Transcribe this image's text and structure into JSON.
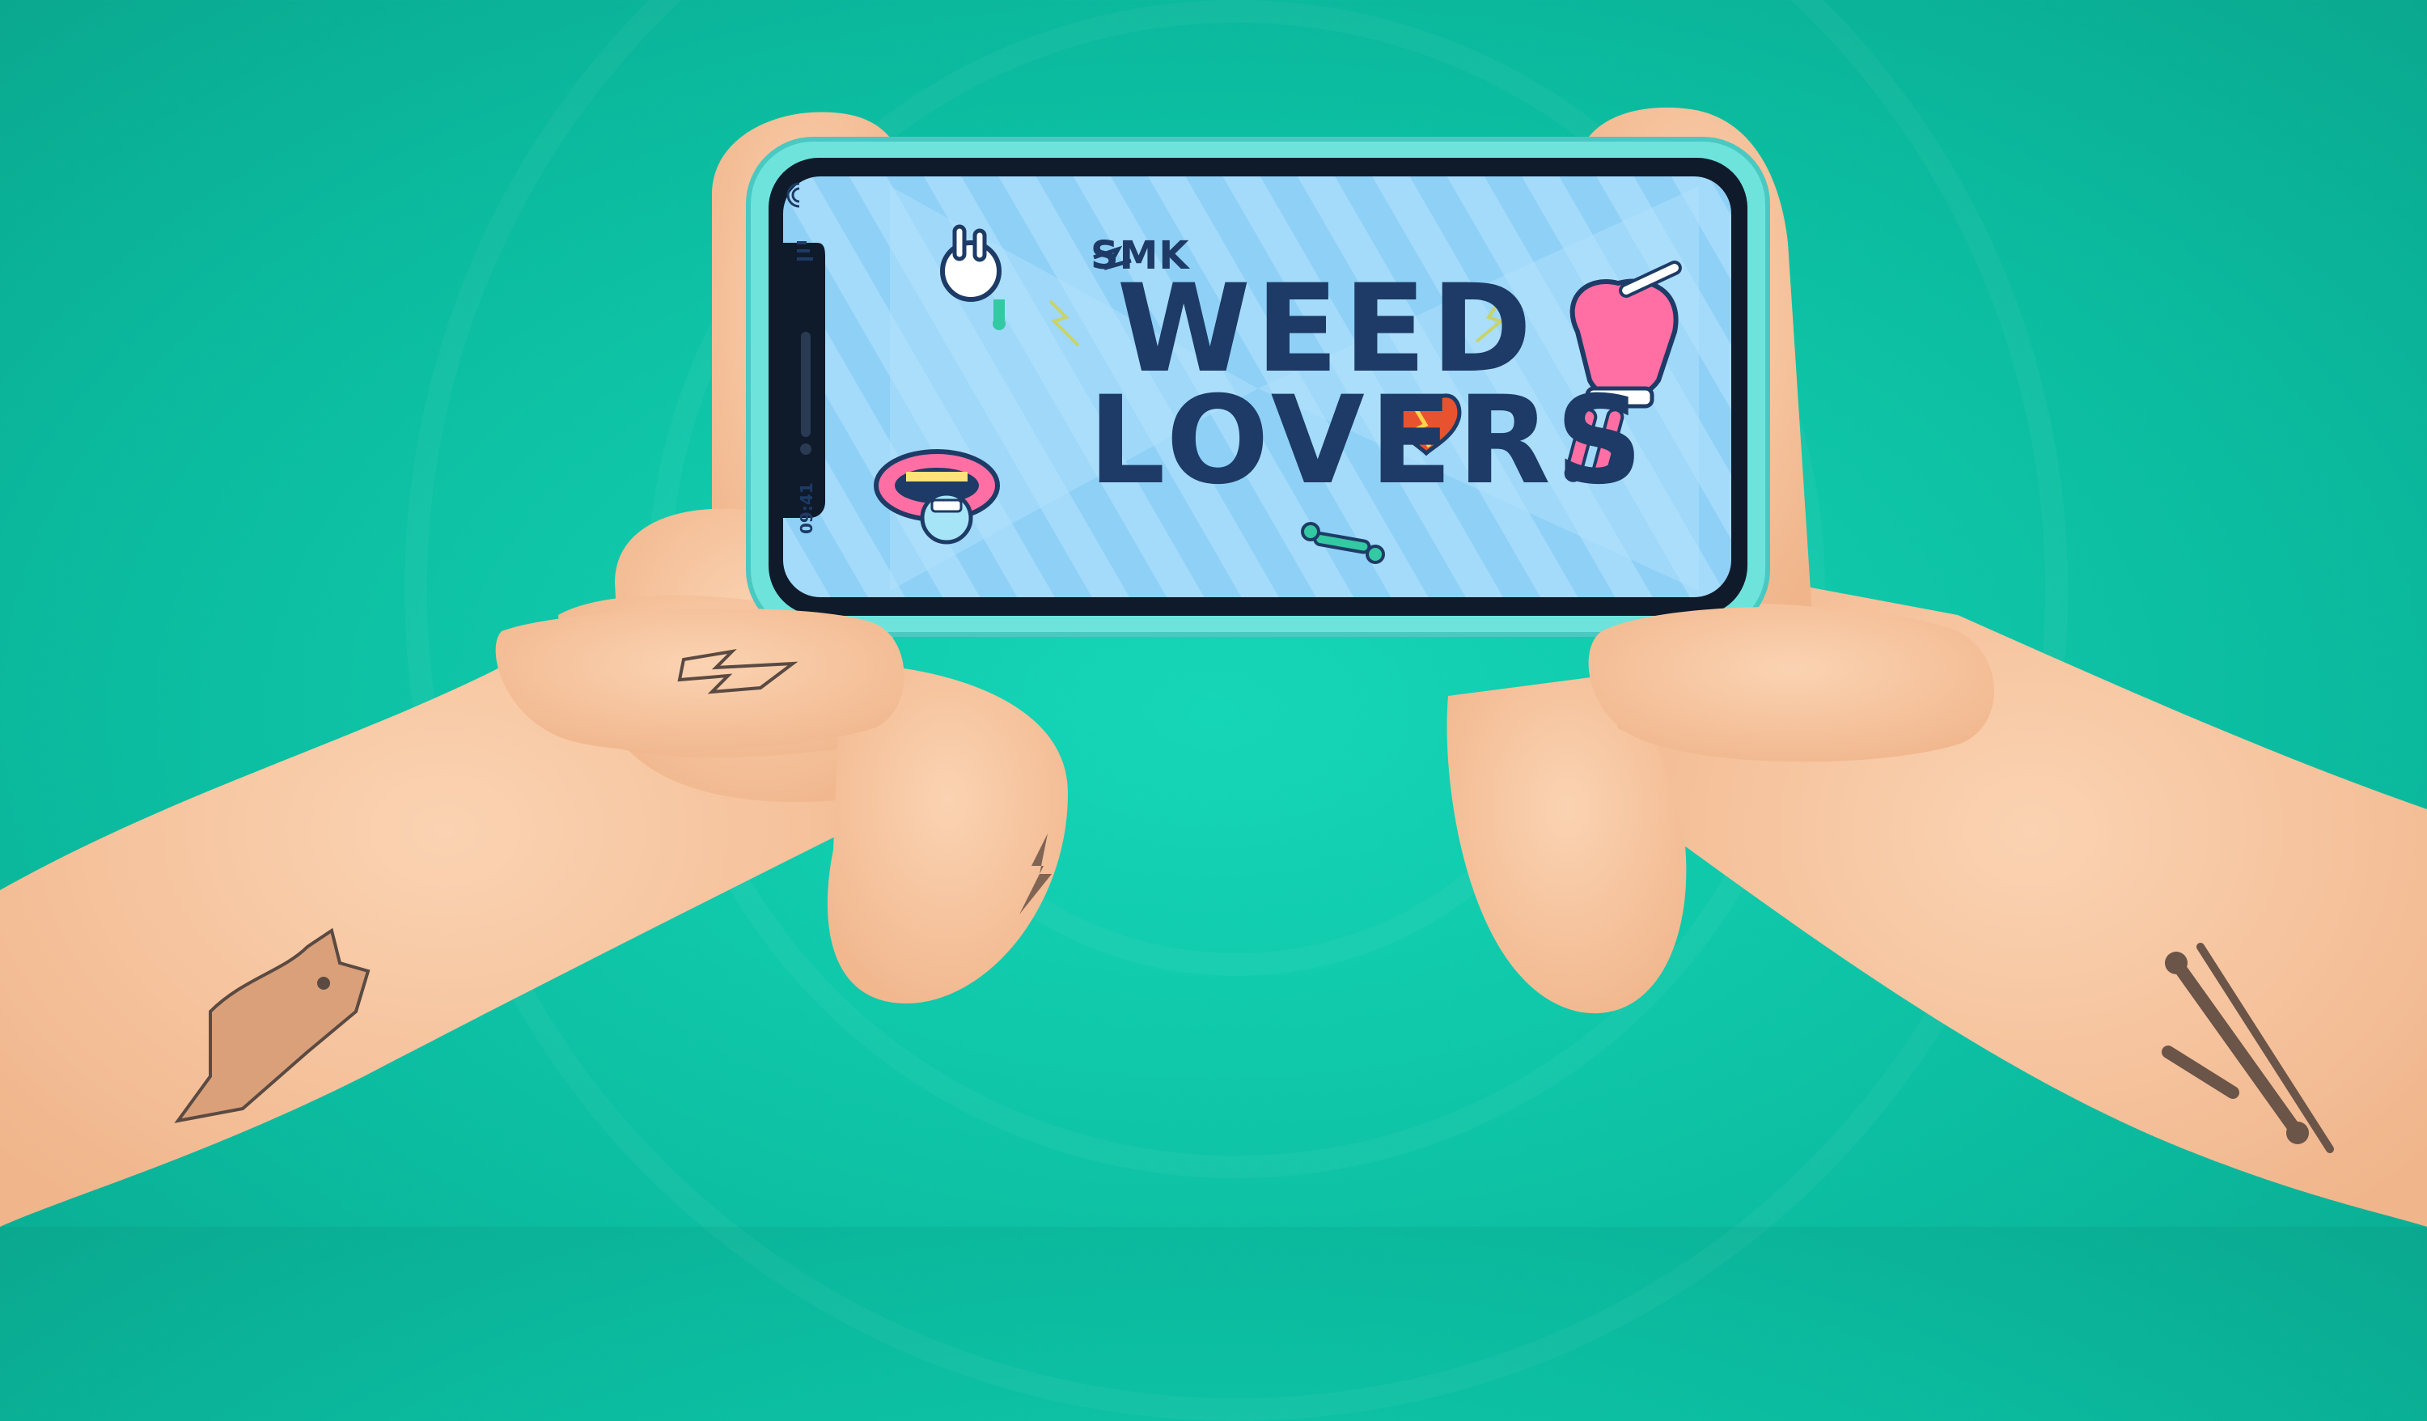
{
  "screen": {
    "brand": "SMK",
    "title_line1": "WEED",
    "title_line2": "LOVERS",
    "clock": "09:41"
  },
  "colors": {
    "background": "#10c8aa",
    "phone_case": "#6ee3dc",
    "screen_bg": "#8fd0f7",
    "title": "#1d3b66",
    "skin": "#f5c29b",
    "tattoo": "#5a4a42",
    "sticker_pink": "#ff6fa4"
  },
  "icons": [
    "wifi-icon",
    "signal-icon",
    "lightning-icon",
    "rock-hand-icon",
    "mouth-sticker-icon",
    "hand-joint-sticker-icon",
    "heart-sticker-icon",
    "bone-sticker-icon",
    "dog-tattoo-icon",
    "bones-tattoo-icon"
  ]
}
